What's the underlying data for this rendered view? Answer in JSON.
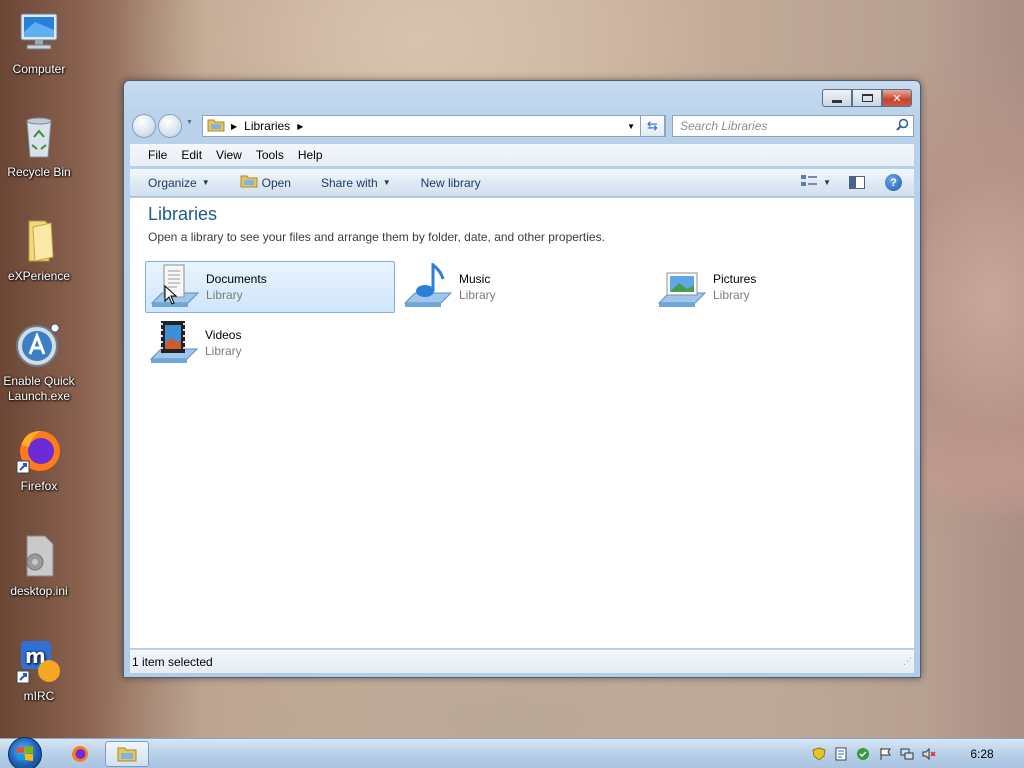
{
  "desktop": {
    "icons": [
      {
        "label": "Computer"
      },
      {
        "label": "Recycle Bin"
      },
      {
        "label": "eXPerience"
      },
      {
        "label": "Enable Quick Launch.exe"
      },
      {
        "label": "Firefox"
      },
      {
        "label": "desktop.ini"
      },
      {
        "label": "mIRC"
      }
    ]
  },
  "window": {
    "address": {
      "crumb": "Libraries"
    },
    "search_placeholder": "Search Libraries",
    "menu": [
      "File",
      "Edit",
      "View",
      "Tools",
      "Help"
    ],
    "commands": {
      "organize": "Organize",
      "open": "Open",
      "share": "Share with",
      "new_library": "New library"
    },
    "content": {
      "title": "Libraries",
      "subtitle": "Open a library to see your files and arrange them by folder, date, and other properties.",
      "items": [
        {
          "name": "Documents",
          "kind": "Library",
          "selected": true
        },
        {
          "name": "Music",
          "kind": "Library"
        },
        {
          "name": "Pictures",
          "kind": "Library"
        },
        {
          "name": "Videos",
          "kind": "Library"
        }
      ]
    },
    "status": "1 item selected"
  },
  "taskbar": {
    "clock": "6:28"
  }
}
